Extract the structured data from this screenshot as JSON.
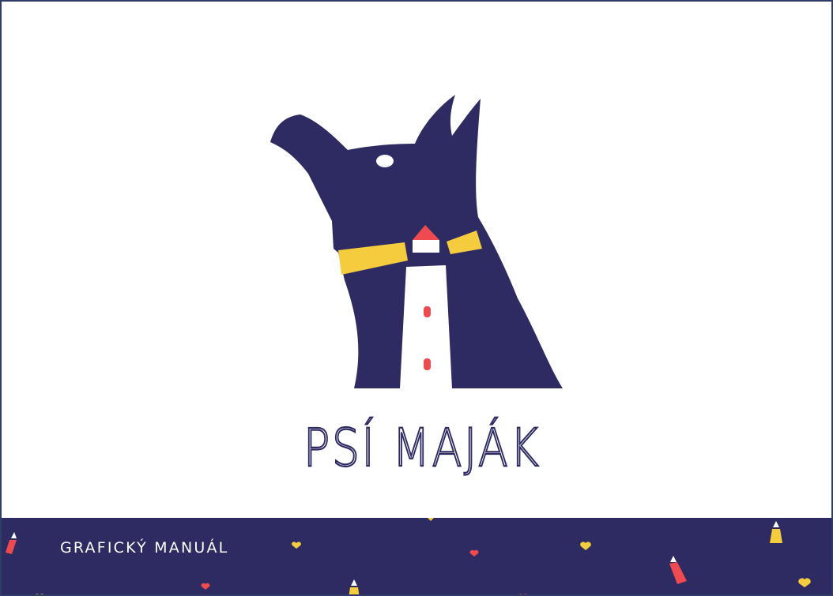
{
  "logo": {
    "wordmark": "PSÍ MAJÁK",
    "colors": {
      "navy": "#2d2b62",
      "yellow": "#f6cc3f",
      "red": "#ee4a4f",
      "white": "#ffffff"
    }
  },
  "footer": {
    "title": "GRAFICKÝ MANUÁL",
    "background": "#2d2b62",
    "pattern_icons": [
      "heart-icon",
      "lighthouse-icon"
    ]
  }
}
